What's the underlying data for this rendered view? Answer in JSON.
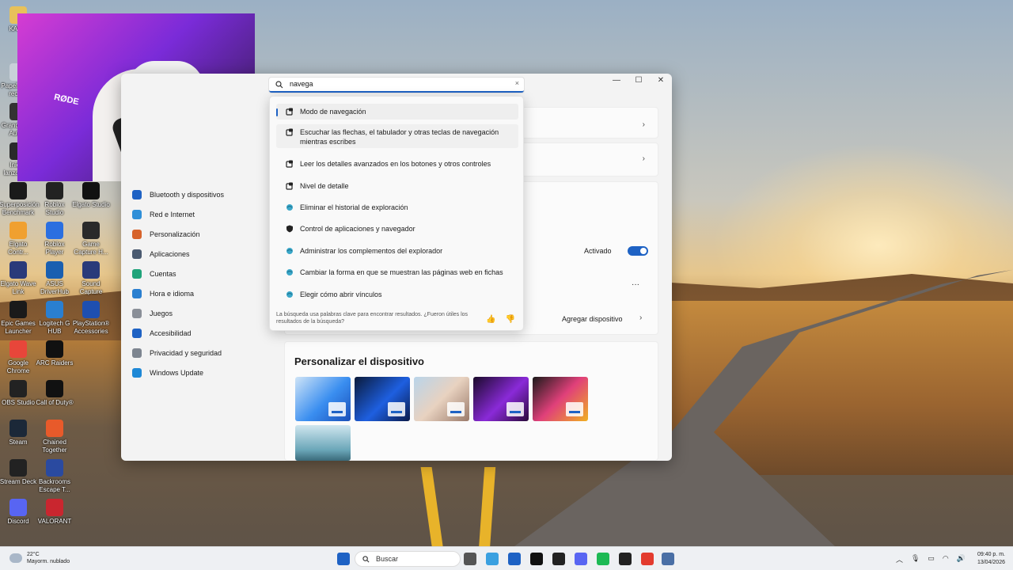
{
  "desktop": {
    "icons": [
      {
        "label": "KAN..."
      },
      {
        "label": "Papelera de recic..."
      },
      {
        "label": "Grand Theft Auto..."
      },
      {
        "label": "Iniciar lanzador..."
      },
      {
        "label": "Superposición Benchmark"
      },
      {
        "label": "Roblox Studio"
      },
      {
        "label": "Elgato Studio"
      },
      {
        "label": "Elgato Contr..."
      },
      {
        "label": "Roblox Player"
      },
      {
        "label": "Game Capture H..."
      },
      {
        "label": "Elgato Wave Link"
      },
      {
        "label": "ASUS DriverHub"
      },
      {
        "label": "Sound Capture"
      },
      {
        "label": "Epic Games Launcher"
      },
      {
        "label": "Logitech G HUB"
      },
      {
        "label": "PlayStation® Accessories"
      },
      {
        "label": "Google Chrome"
      },
      {
        "label": "ARC Raiders"
      },
      {
        "label": "OBS Studio"
      },
      {
        "label": "Call of Duty®"
      },
      {
        "label": "Steam"
      },
      {
        "label": "Chained Together"
      },
      {
        "label": "Stream Deck"
      },
      {
        "label": "Backrooms Escape T..."
      },
      {
        "label": "Discord"
      },
      {
        "label": "VALORANT"
      }
    ]
  },
  "webcam": {
    "mic_brand": "RØDE"
  },
  "settings": {
    "window_controls": {
      "minimize": "—",
      "maximize": "☐",
      "close": "✕"
    },
    "nav": [
      {
        "label": "Bluetooth y dispositivos",
        "color": "#1e62c4"
      },
      {
        "label": "Red e Internet",
        "color": "#2f8fd8"
      },
      {
        "label": "Personalización",
        "color": "#d7632b"
      },
      {
        "label": "Aplicaciones",
        "color": "#4a5a70"
      },
      {
        "label": "Cuentas",
        "color": "#1fa37a"
      },
      {
        "label": "Hora e idioma",
        "color": "#2a7fd0"
      },
      {
        "label": "Juegos",
        "color": "#8a8f98"
      },
      {
        "label": "Accesibilidad",
        "color": "#1e62c4"
      },
      {
        "label": "Privacidad y seguridad",
        "color": "#7d8590"
      },
      {
        "label": "Windows Update",
        "color": "#1e88d6"
      }
    ],
    "status_label": "Activado",
    "more_label": "···",
    "add_device_label": "Agregar dispositivo",
    "chevron": "›",
    "personalize_title": "Personalizar el dispositivo",
    "thumbnails": [
      {
        "name": "bloom-light"
      },
      {
        "name": "bloom-dark"
      },
      {
        "name": "spotlight"
      },
      {
        "name": "glow"
      },
      {
        "name": "flower"
      },
      {
        "name": "lake"
      }
    ]
  },
  "search": {
    "query": "navega",
    "clear": "×",
    "results": [
      {
        "label": "Modo de navegación",
        "icon": "settings-icon"
      },
      {
        "label": "Escuchar las flechas, el tabulador y otras teclas de navegación mientras escribes",
        "icon": "settings-icon"
      },
      {
        "label": "Leer los detalles avanzados en los botones y otros controles",
        "icon": "settings-icon"
      },
      {
        "label": "Nivel de detalle",
        "icon": "settings-icon"
      },
      {
        "label": "Eliminar el historial de exploración",
        "icon": "globe-icon"
      },
      {
        "label": "Control de aplicaciones y navegador",
        "icon": "shield-icon"
      },
      {
        "label": "Administrar los complementos del explorador",
        "icon": "globe-icon"
      },
      {
        "label": "Cambiar la forma en que se muestran las páginas web en fichas",
        "icon": "globe-icon"
      },
      {
        "label": "Elegir cómo abrir vínculos",
        "icon": "globe-icon"
      }
    ],
    "footer": "La búsqueda usa palabras clave para encontrar resultados. ¿Fueron útiles los resultados de la búsqueda?",
    "thumbs_up": "👍",
    "thumbs_down": "👎"
  },
  "taskbar": {
    "weather_temp": "22°C",
    "weather_desc": "Mayorm. nublado",
    "search_label": "Buscar",
    "tray": {
      "chevron": "︿",
      "mic": "🎙",
      "display": "▭",
      "wifi": "◠",
      "volume": "🔊"
    },
    "time": "09:40 p. m.",
    "date": "13/04/2026",
    "apps": [
      {
        "name": "start",
        "color": "#1e62c4"
      },
      {
        "name": "task-view",
        "color": "#555555"
      },
      {
        "name": "copilot",
        "color": "#3aa0e0"
      },
      {
        "name": "store",
        "color": "#1e62c4"
      },
      {
        "name": "capcut",
        "color": "#111111"
      },
      {
        "name": "notion",
        "color": "#222222"
      },
      {
        "name": "discord",
        "color": "#5865f2"
      },
      {
        "name": "spotify",
        "color": "#1db954"
      },
      {
        "name": "obs",
        "color": "#222222"
      },
      {
        "name": "chrome",
        "color": "#e33b2e"
      },
      {
        "name": "settings",
        "color": "#4a6fa5"
      }
    ]
  }
}
